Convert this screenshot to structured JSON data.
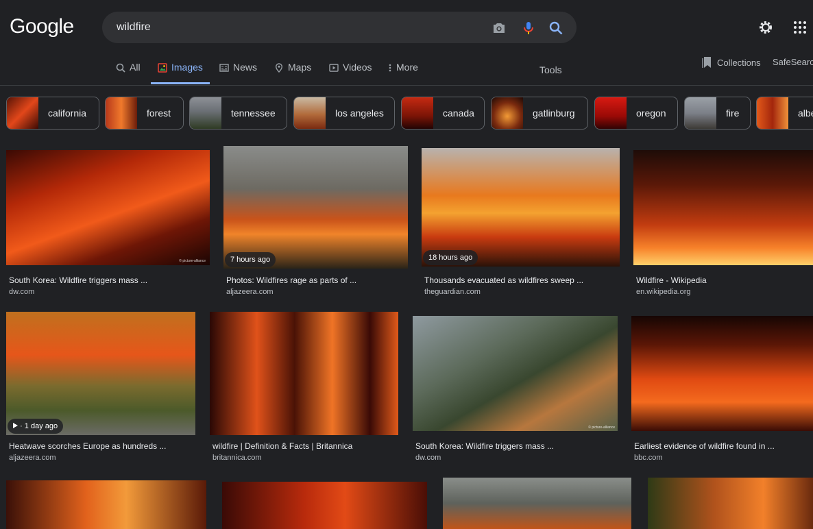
{
  "header": {
    "logo": "Google",
    "query": "wildfire",
    "icons": [
      "camera-icon",
      "microphone-icon",
      "search-icon",
      "gear-icon",
      "apps-grid-icon"
    ]
  },
  "tabs": [
    {
      "label": "All",
      "icon": "search-icon"
    },
    {
      "label": "Images",
      "icon": "images-icon",
      "active": true
    },
    {
      "label": "News",
      "icon": "news-icon"
    },
    {
      "label": "Maps",
      "icon": "map-pin-icon"
    },
    {
      "label": "Videos",
      "icon": "video-icon"
    },
    {
      "label": "More",
      "icon": "kebab-icon"
    }
  ],
  "tools_label": "Tools",
  "collections_label": "Collections",
  "safesearch_label": "SafeSearch",
  "chips": [
    "california",
    "forest",
    "tennessee",
    "los angeles",
    "canada",
    "gatlinburg",
    "oregon",
    "fire",
    "alberta"
  ],
  "results": [
    {
      "title": "South Korea: Wildfire triggers mass ...",
      "source": "dw.com",
      "badge": ""
    },
    {
      "title": "Photos: Wildfires rage as parts of ...",
      "source": "aljazeera.com",
      "badge": "7 hours ago"
    },
    {
      "title": "Thousands evacuated as wildfires sweep ...",
      "source": "theguardian.com",
      "badge": "18 hours ago"
    },
    {
      "title": "Wildfire - Wikipedia",
      "source": "en.wikipedia.org",
      "badge": ""
    },
    {
      "title": "Heatwave scorches Europe as hundreds ...",
      "source": "aljazeera.com",
      "badge": "· 1 day ago"
    },
    {
      "title": "wildfire | Definition & Facts | Britannica",
      "source": "britannica.com",
      "badge": ""
    },
    {
      "title": "South Korea: Wildfire triggers mass ...",
      "source": "dw.com",
      "badge": ""
    },
    {
      "title": "Earliest evidence of wildfire found in ...",
      "source": "bbc.com",
      "badge": ""
    }
  ],
  "watermark": "© picture-alliance"
}
